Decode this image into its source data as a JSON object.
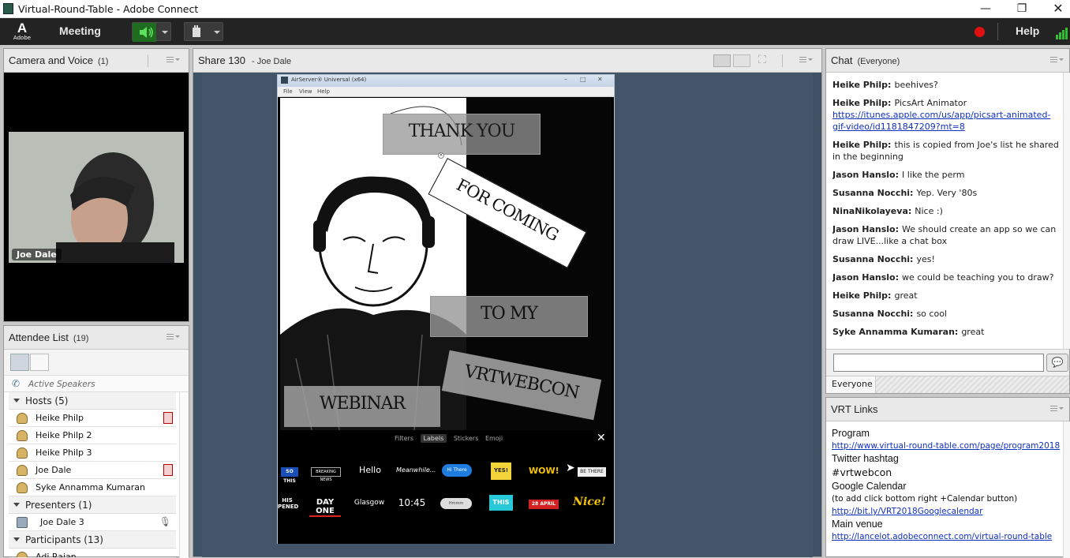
{
  "window": {
    "title": "Virtual-Round-Table - Adobe Connect"
  },
  "menubar": {
    "logo": "Adobe",
    "meeting": "Meeting",
    "help": "Help"
  },
  "camera_pod": {
    "title": "Camera and Voice",
    "count": "(1)",
    "video_name": "Joe Dale"
  },
  "attendee_pod": {
    "title": "Attendee List",
    "count": "(19)",
    "active_speakers": "Active Speakers",
    "groups": [
      {
        "label": "Hosts (5)"
      },
      {
        "label": "Presenters (1)"
      },
      {
        "label": "Participants (13)"
      }
    ],
    "hosts": [
      "Heike  Philp",
      "Heike  Philp 2",
      "Heike  Philp 3",
      "Joe Dale",
      "Syke Annamma Kumaran"
    ],
    "presenters": [
      "Joe Dale 3"
    ],
    "participants": [
      "Adi Rajan"
    ]
  },
  "share_pod": {
    "title": "Share 130",
    "presenter": "- Joe Dale",
    "airserver": {
      "title": "AirServer® Universal (x64)",
      "menus": [
        "File",
        "View",
        "Help"
      ]
    },
    "poster": {
      "thank_you": "THANK YOU",
      "for_coming": "FOR COMING",
      "to_my": "TO MY",
      "vrtwebcon": "VRTWEBCON",
      "webinar": "WEBINAR"
    },
    "editor_tabs": [
      "Filters",
      "Labels",
      "Stickers",
      "Emoji"
    ],
    "stickers_row1": [
      "SO THIS",
      "BREAKING NEWS",
      "Hello",
      "Meanwhile...",
      "Hi There",
      "YES!",
      "WOW!",
      "BE THERE"
    ],
    "stickers_row2": [
      "HIS PENED",
      "DAY ONE",
      "Glasgow",
      "10:45",
      "Hmmm",
      "THIS",
      "28 APRIL",
      "Nice!"
    ]
  },
  "chat_pod": {
    "title": "Chat",
    "audience": "(Everyone)",
    "recipient": "Everyone",
    "messages": [
      {
        "name": "Heike  Philp:",
        "text": "beehives?"
      },
      {
        "name": "Heike  Philp:",
        "text": "PicsArt Animator",
        "link": "https://itunes.apple.com/us/app/picsart-animated-gif-video/id1181847209?mt=8"
      },
      {
        "name": "Heike  Philp:",
        "text": "this is copied from Joe's list he shared in the beginning"
      },
      {
        "name": "Jason Hanslo:",
        "text": "I like the perm"
      },
      {
        "name": "Susanna Nocchi:",
        "text": "Yep. Very '80s"
      },
      {
        "name": "NinaNikolayeva:",
        "text": "Nice :)"
      },
      {
        "name": "Jason Hanslo:",
        "text": "We should create an app so we can draw LIVE...like a chat box"
      },
      {
        "name": "Susanna Nocchi:",
        "text": "yes!"
      },
      {
        "name": "Jason Hanslo:",
        "text": "we could be teaching you to draw?"
      },
      {
        "name": "Heike  Philp:",
        "text": "great"
      },
      {
        "name": "Susanna Nocchi:",
        "text": "so cool"
      },
      {
        "name": "Syke Annamma Kumaran:",
        "text": "great"
      }
    ]
  },
  "links_pod": {
    "title": "VRT Links",
    "sections": [
      {
        "heading": "Program",
        "lines": [
          {
            "text": "http://www.virtual-round-table.com/page/program2018",
            "link": true
          }
        ]
      },
      {
        "heading": "Twitter hashtag",
        "lines": [
          {
            "text": "#vrtwebcon",
            "link": false,
            "big": true
          }
        ]
      },
      {
        "heading": "Google Calendar",
        "lines": [
          {
            "text": "(to add click bottom right +Calendar button)",
            "link": false
          },
          {
            "text": "http://bit.ly/VRT2018Googlecalendar",
            "link": true
          }
        ]
      },
      {
        "heading": "Main venue",
        "lines": [
          {
            "text": "http://lancelot.adobeconnect.com/virtual-round-table",
            "link": true
          }
        ]
      }
    ]
  },
  "colors": {
    "record": "#e01010",
    "speaker_green": "#37c337",
    "share_bg": "#3e5266",
    "link": "#1030c0"
  }
}
